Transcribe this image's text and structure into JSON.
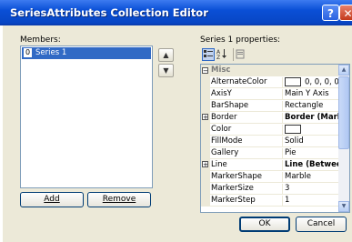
{
  "window": {
    "title": "SeriesAttributes Collection Editor",
    "help_label": "?",
    "close_label": "✕"
  },
  "members": {
    "label": "Members:",
    "items": [
      {
        "index": "0",
        "name": "Series 1"
      }
    ],
    "up_arrow": "▲",
    "down_arrow": "▼",
    "add_label": "Add",
    "remove_label": "Remove"
  },
  "properties": {
    "label": "Series 1 properties:",
    "toolbar": [
      "categorized-icon",
      "alphabetical-icon",
      "property-pages-icon"
    ],
    "category": "Misc",
    "rows": [
      {
        "name": "AlternateColor",
        "value": "0, 0, 0, 0",
        "swatch": true,
        "bold": false,
        "expand": false
      },
      {
        "name": "AxisY",
        "value": "Main Y Axis",
        "swatch": false,
        "bold": false,
        "expand": false
      },
      {
        "name": "BarShape",
        "value": "Rectangle",
        "swatch": false,
        "bold": false,
        "expand": false
      },
      {
        "name": "Border",
        "value": "Border (Markers",
        "swatch": false,
        "bold": true,
        "expand": true
      },
      {
        "name": "Color",
        "value": "",
        "swatch": true,
        "bold": false,
        "expand": false
      },
      {
        "name": "FillMode",
        "value": "Solid",
        "swatch": false,
        "bold": false,
        "expand": false
      },
      {
        "name": "Gallery",
        "value": "Pie",
        "swatch": false,
        "bold": false,
        "expand": false
      },
      {
        "name": "Line",
        "value": "Line (Between M",
        "swatch": false,
        "bold": true,
        "expand": true
      },
      {
        "name": "MarkerShape",
        "value": "Marble",
        "swatch": false,
        "bold": false,
        "expand": false
      },
      {
        "name": "MarkerSize",
        "value": "3",
        "swatch": false,
        "bold": false,
        "expand": false
      },
      {
        "name": "MarkerStep",
        "value": "1",
        "swatch": false,
        "bold": false,
        "expand": false
      }
    ]
  },
  "footer": {
    "ok_label": "OK",
    "cancel_label": "Cancel"
  },
  "colors": {
    "titlebar": "#0a4fd6",
    "dialog_bg": "#ece9d8",
    "selection": "#316ac5"
  }
}
